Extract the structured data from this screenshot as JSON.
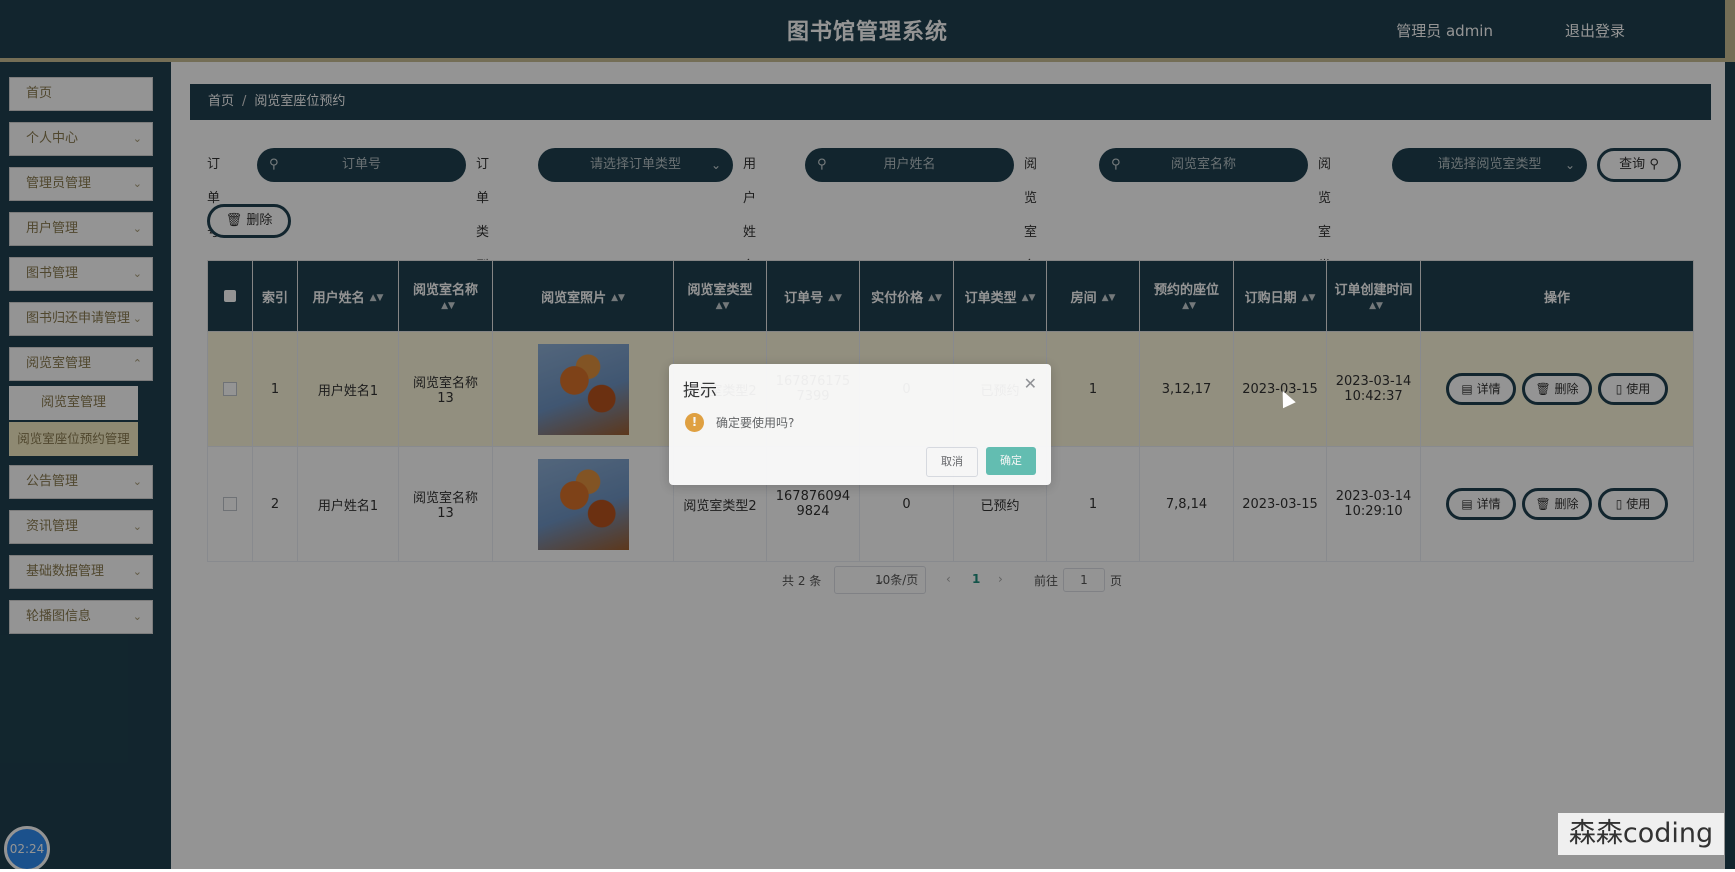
{
  "header": {
    "title": "图书馆管理系统",
    "user": "管理员 admin",
    "logout": "退出登录"
  },
  "sidebar": {
    "items": [
      {
        "label": "首页"
      },
      {
        "label": "个人中心"
      },
      {
        "label": "管理员管理"
      },
      {
        "label": "用户管理"
      },
      {
        "label": "图书管理"
      },
      {
        "label": "图书归还申请管理"
      },
      {
        "label": "阅览室管理"
      },
      {
        "label": "公告管理"
      },
      {
        "label": "资讯管理"
      },
      {
        "label": "基础数据管理"
      },
      {
        "label": "轮播图信息"
      }
    ],
    "subitems": [
      {
        "label": "阅览室管理"
      },
      {
        "label": "阅览室座位预约管理"
      }
    ],
    "timer": "02:24"
  },
  "breadcrumb": {
    "home": "首页",
    "sep": "/",
    "current": "阅览室座位预约"
  },
  "filters": {
    "order_no_label": "订单号",
    "order_no_placeholder": "订单号",
    "order_type_label": "订单类型",
    "order_type_placeholder": "请选择订单类型",
    "user_name_label": "用户姓名",
    "user_name_placeholder": "用户姓名",
    "room_name_label": "阅览室名称",
    "room_name_placeholder": "阅览室名称",
    "room_type_label": "阅览室类型",
    "room_type_placeholder": "请选择阅览室类型",
    "query": "查询",
    "delete": "删除"
  },
  "table": {
    "headers": {
      "index": "索引",
      "user_name": "用户姓名",
      "room_name": "阅览室名称",
      "room_photo": "阅览室照片",
      "room_type": "阅览室类型",
      "order_no": "订单号",
      "price": "实付价格",
      "order_type": "订单类型",
      "room": "房间",
      "seats": "预约的座位",
      "order_date": "订购日期",
      "created": "订单创建时间",
      "ops": "操作"
    },
    "rows": [
      {
        "index": "1",
        "user_name": "用户姓名1",
        "room_name": "阅览室名称13",
        "room_type": "阅览室类型2",
        "order_no": "1678761757399",
        "price": "0",
        "order_type": "已预约",
        "room": "1",
        "seats": "3,12,17",
        "order_date": "2023-03-15",
        "created_date": "2023-03-14",
        "created_time": "10:42:37"
      },
      {
        "index": "2",
        "user_name": "用户姓名1",
        "room_name": "阅览室名称13",
        "room_type": "阅览室类型2",
        "order_no": "1678760949824",
        "price": "0",
        "order_type": "已预约",
        "room": "1",
        "seats": "7,8,14",
        "order_date": "2023-03-15",
        "created_date": "2023-03-14",
        "created_time": "10:29:10"
      }
    ],
    "ops": {
      "detail": "详情",
      "delete": "删除",
      "use": "使用"
    }
  },
  "pagination": {
    "total": "共 2 条",
    "page_size": "10条/页",
    "current": "1",
    "goto": "前往",
    "goto_value": "1",
    "page_suffix": "页"
  },
  "dialog": {
    "title": "提示",
    "message": "确定要使用吗?",
    "cancel": "取消",
    "confirm": "确定"
  },
  "watermark": "森森coding",
  "colors": {
    "primary": "#1f4150",
    "accent": "#c9bd95",
    "confirm": "#5fc1b4",
    "warning": "#e6a23c"
  }
}
